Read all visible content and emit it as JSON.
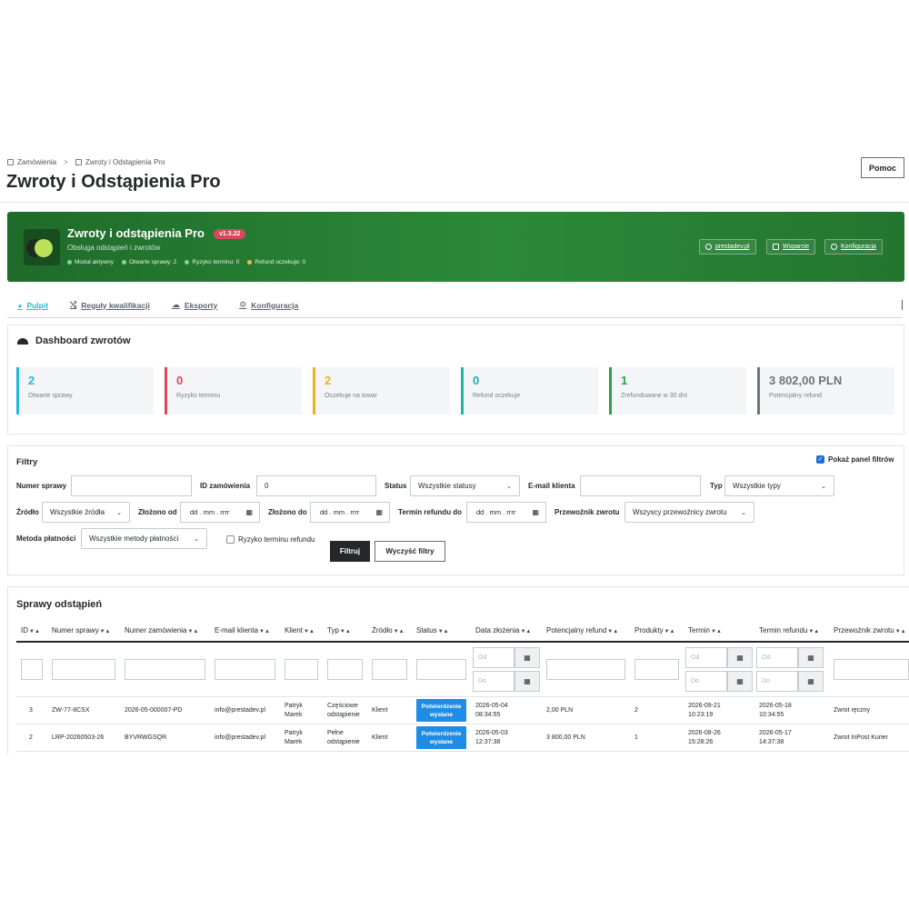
{
  "breadcrumb": {
    "parent": "Zamówienia",
    "separator": ">",
    "current": "Zwroty i Odstąpienia Pro"
  },
  "page_title": "Zwroty i Odstąpienia Pro",
  "help_label": "Pomoc",
  "banner": {
    "title": "Zwroty i odstąpienia Pro",
    "version": "v1.3.22",
    "subtitle": "Obsługa odstąpień i zwrotów",
    "stats": [
      {
        "label": "Moduł aktywny",
        "color": "#7bd88f"
      },
      {
        "label": "Otwarte sprawy: 2",
        "color": "#7bd88f"
      },
      {
        "label": "Ryzyko terminu: 0",
        "color": "#7bd88f"
      },
      {
        "label": "Refund oczekuje: 0",
        "color": "#f5b942"
      }
    ],
    "buttons": [
      "prestadev.pl",
      "Wsparcie",
      "Konfiguracja"
    ]
  },
  "tabs": [
    {
      "label": "Pulpit",
      "icon": "gauge-icon",
      "active": true
    },
    {
      "label": "Reguły kwalifikacji",
      "icon": "shuffle-icon",
      "active": false
    },
    {
      "label": "Eksporty",
      "icon": "cloud-download-icon",
      "active": false
    },
    {
      "label": "Konfiguracja",
      "icon": "gears-icon",
      "active": false
    }
  ],
  "dashboard": {
    "title": "Dashboard zwrotów",
    "kpis": [
      {
        "value": "2",
        "label": "Otwarte sprawy",
        "color": "#25b9d7"
      },
      {
        "value": "0",
        "label": "Ryzyko terminu",
        "color": "#d9475c"
      },
      {
        "value": "2",
        "label": "Oczekuje na towar",
        "color": "#e6b422"
      },
      {
        "value": "0",
        "label": "Refund oczekuje",
        "color": "#20b2aa"
      },
      {
        "value": "1",
        "label": "Zrefundowane w 30 dni",
        "color": "#2e9e4a"
      },
      {
        "value": "3 802,00 PLN",
        "label": "Potencjalny refund",
        "color": "#6c757d"
      }
    ]
  },
  "filters": {
    "title": "Filtry",
    "show_panel_label": "Pokaż panel filtrów",
    "case_number_label": "Numer sprawy",
    "case_number_value": "",
    "order_id_label": "ID zamówienia",
    "order_id_value": "0",
    "status_label": "Status",
    "status_value": "Wszystkie statusy",
    "email_label": "E-mail klienta",
    "email_value": "",
    "type_label": "Typ",
    "type_value": "Wszystkie typy",
    "source_label": "Źródło",
    "source_value": "Wszystkie źródła",
    "filed_from_label": "Złożono od",
    "filed_to_label": "Złożono do",
    "refund_deadline_label": "Termin refundu do",
    "date_placeholder": "dd . mm . rrrr",
    "carrier_label": "Przewoźnik zwrotu",
    "carrier_value": "Wszyscy przewoźnicy zwrotu",
    "payment_label": "Metoda płatności",
    "payment_value": "Wszystkie metody płatności",
    "risk_label": "Ryzyko terminu refundu",
    "filter_btn": "Filtruj",
    "clear_btn": "Wyczyść filtry"
  },
  "cases": {
    "title": "Sprawy odstąpień",
    "columns": [
      "ID",
      "Numer sprawy",
      "Numer zamówienia",
      "E-mail klienta",
      "Klient",
      "Typ",
      "Źródło",
      "Status",
      "Data złożenia",
      "Potencjalny refund",
      "Produkty",
      "Termin",
      "Termin refundu",
      "Przewoźnik zwrotu"
    ],
    "sort_glyph": "▼▲",
    "from_placeholder": "Od",
    "to_placeholder": "Do",
    "rows": [
      {
        "id": "3",
        "case": "ZW-77-8CSX",
        "order": "2026-05-000007-PD",
        "email": "info@prestadev.pl",
        "client1": "Patryk",
        "client2": "Marek",
        "type1": "Częściowe",
        "type2": "odstąpienie",
        "source": "Klient",
        "status1": "Potwierdzenie",
        "status2": "wysłane",
        "date1": "2026-05-04",
        "date2": "08:34:55",
        "refund": "2,00 PLN",
        "products": "2",
        "deadline1": "2026-09-21",
        "deadline2": "10:23:19",
        "refdl1": "2026-05-18",
        "refdl2": "10:34:55",
        "carrier": "Zwrot ręczny"
      },
      {
        "id": "2",
        "case": "LRP-20260503-26",
        "order": "BYVRWGSQR",
        "email": "info@prestadev.pl",
        "client1": "Patryk",
        "client2": "Marek",
        "type1": "Pełne",
        "type2": "odstąpienie",
        "source": "Klient",
        "status1": "Potwierdzenie",
        "status2": "wysłane",
        "date1": "2026-05-03",
        "date2": "12:37:38",
        "refund": "3 800,00 PLN",
        "products": "1",
        "deadline1": "2026-08-26",
        "deadline2": "15:28:26",
        "refdl1": "2026-05-17",
        "refdl2": "14:37:38",
        "carrier": "Zwrot InPost Kurier"
      }
    ]
  }
}
